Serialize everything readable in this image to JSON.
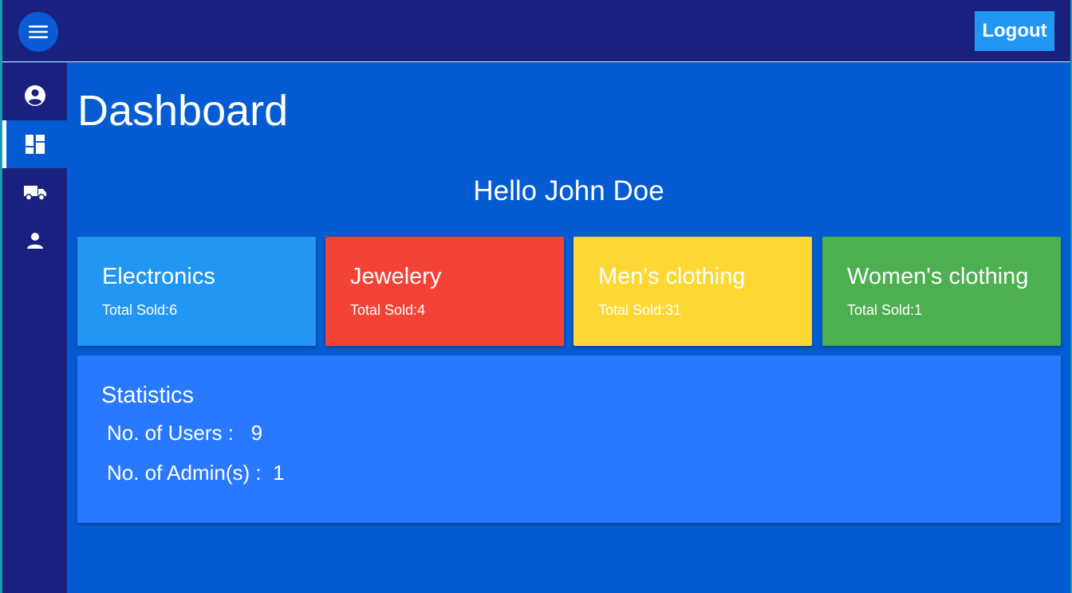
{
  "header": {
    "menu_icon": "menu-icon",
    "logout_label": "Logout"
  },
  "sidebar": {
    "items": [
      {
        "icon": "account-circle-icon",
        "active": false
      },
      {
        "icon": "dashboard-icon",
        "active": true
      },
      {
        "icon": "truck-icon",
        "active": false
      },
      {
        "icon": "person-icon",
        "active": false
      }
    ]
  },
  "main": {
    "title": "Dashboard",
    "greeting": "Hello John Doe",
    "cards": [
      {
        "name": "Electronics",
        "sold_label": "Total Sold:",
        "sold": "6",
        "color": "#2196f3"
      },
      {
        "name": "Jewelery",
        "sold_label": "Total Sold:",
        "sold": "4",
        "color": "#f44336"
      },
      {
        "name": "Men's clothing",
        "sold_label": "Total Sold:",
        "sold": "31",
        "color": "#fdd835"
      },
      {
        "name": "Women's clothing",
        "sold_label": "Total Sold:",
        "sold": "1",
        "color": "#4caf50"
      }
    ],
    "statistics": {
      "title": "Statistics",
      "users_label": "No. of Users :",
      "users_value": "9",
      "admins_label": "No. of Admin(s) :",
      "admins_value": "1"
    }
  },
  "colors": {
    "appbar": "#1a207e",
    "content_bg": "#055cd2",
    "stats_bg": "#2979ff",
    "logout_bg": "#2196f3"
  }
}
